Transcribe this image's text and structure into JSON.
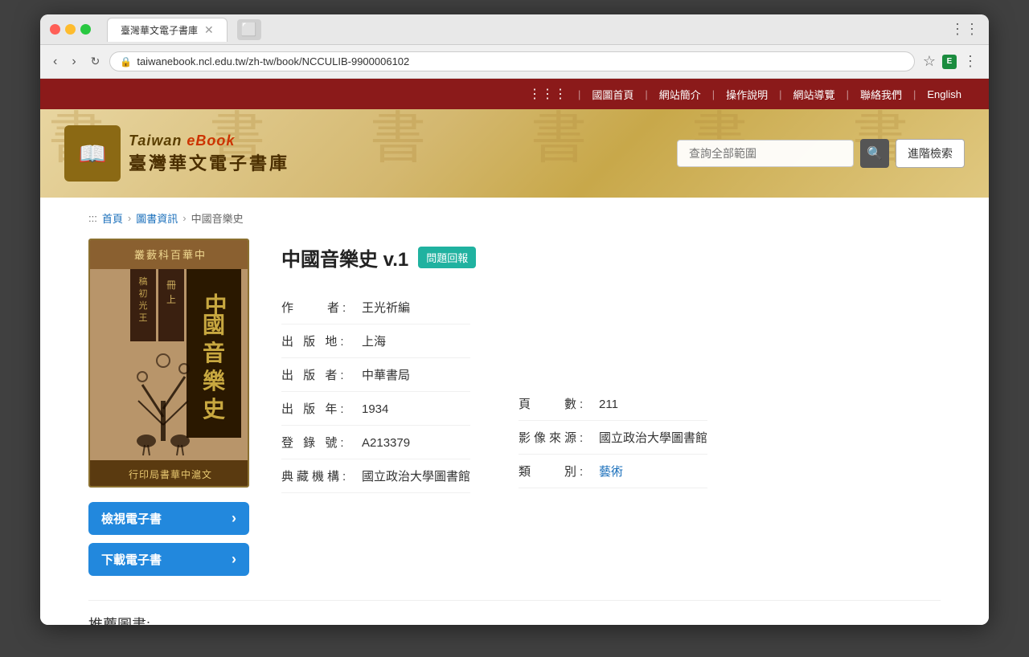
{
  "browser": {
    "tab_title": "臺灣華文電子書庫",
    "url": "taiwanebook.ncl.edu.tw/zh-tw/book/NCCULIB-9900006102",
    "favicon_text": "E"
  },
  "nav": {
    "dots": "⋮⋮⋮",
    "divider": "|",
    "items": [
      {
        "id": "home",
        "label": "國圖首頁"
      },
      {
        "id": "about",
        "label": "網站簡介"
      },
      {
        "id": "help",
        "label": "操作說明"
      },
      {
        "id": "guide",
        "label": "網站導覽"
      },
      {
        "id": "contact",
        "label": "聯絡我們"
      },
      {
        "id": "english",
        "label": "English"
      }
    ]
  },
  "header": {
    "logo_en_1": "Taiwan",
    "logo_en_2": "eBook",
    "logo_zh": "臺灣華文電子書庫",
    "search_placeholder": "查詢全部範圍",
    "advanced_btn": "進階檢索",
    "search_icon": "🔍"
  },
  "breadcrumb": {
    "dots": ":::",
    "items": [
      {
        "label": "首頁",
        "link": true
      },
      {
        "label": "圖書資訊",
        "link": true
      },
      {
        "label": "中國音樂史",
        "link": false
      }
    ]
  },
  "book": {
    "title": "中國音樂史 v.1",
    "report_badge": "問題回報",
    "cover": {
      "top_text": "叢藪科百華中",
      "main_title": "中國音樂史",
      "subtitle_top": "冊 上",
      "subtitle_mid": "稿 初 光 王",
      "bottom_text": "行印局書華中滬文"
    },
    "fields": [
      {
        "label": "作　　者:",
        "value": "王光祈編",
        "col": 1
      },
      {
        "label": "出 版 地:",
        "value": "上海",
        "col": 1
      },
      {
        "label": "出 版 者:",
        "value": "中華書局",
        "col": 1
      },
      {
        "label": "出 版 年:",
        "value": "1934",
        "col": 1
      },
      {
        "label": "頁　　數:",
        "value": "211",
        "col": 2,
        "row": 4
      },
      {
        "label": "登 錄 號:",
        "value": "A213379",
        "col": 1
      },
      {
        "label": "影像來源:",
        "value": "國立政治大學圖書館",
        "col": 2,
        "row": 5
      },
      {
        "label": "典藏機構:",
        "value": "國立政治大學圖書館",
        "col": 1
      },
      {
        "label": "類　　別:",
        "value": "藝術",
        "col": 2,
        "row": 6,
        "link": true
      }
    ],
    "view_btn": "檢視電子書",
    "download_btn": "下載電子書",
    "btn_arrow": "›"
  },
  "recommended": {
    "title": "推薦圖書:"
  }
}
